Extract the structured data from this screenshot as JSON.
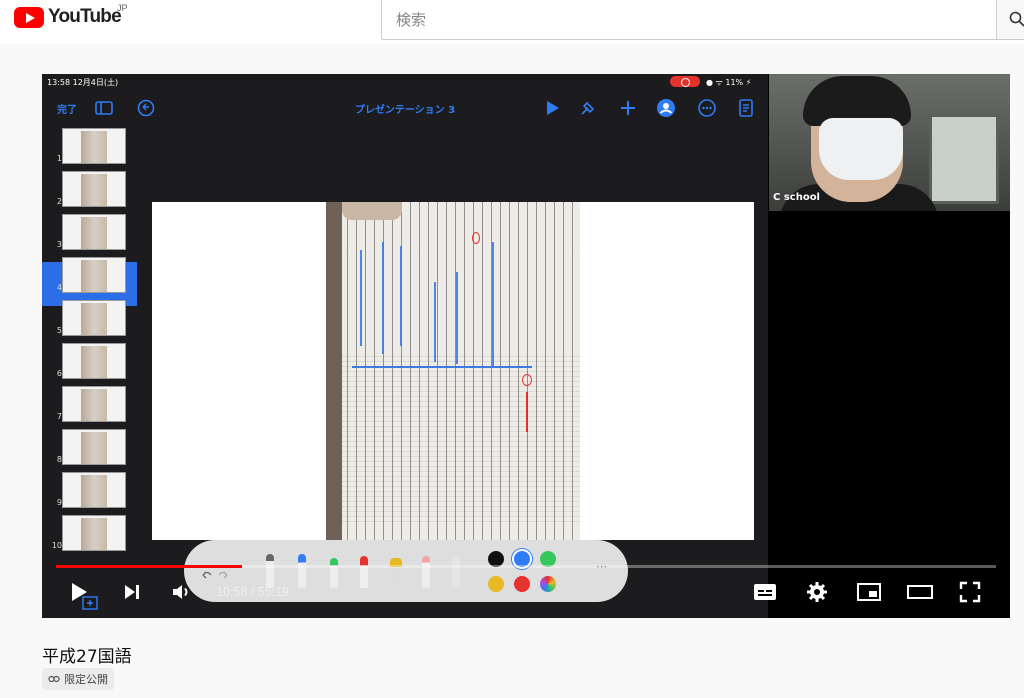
{
  "header": {
    "logo_text": "YouTube",
    "region": "JP",
    "search_placeholder": "検索"
  },
  "ipad": {
    "status_time": "13:58  12月4日(土)",
    "status_right": "● ᯤ 11% ⚡",
    "toolbar_done": "完了",
    "presentation_title": "プレゼンテーション 3",
    "slide_numbers": [
      "1",
      "2",
      "3",
      "4",
      "5",
      "6",
      "7",
      "8",
      "9",
      "10"
    ],
    "selected_slide": "3"
  },
  "webcam": {
    "label": "C school"
  },
  "palette": {
    "colors": [
      "#111111",
      "#2f7cf6",
      "#35c759",
      "#e8b923",
      "#e5322c"
    ],
    "more": "···"
  },
  "player": {
    "time_current": "10:58",
    "time_separator": " / ",
    "time_total": "55:19",
    "progress": 0.198
  },
  "video": {
    "title": "平成27国語",
    "visibility": "限定公開"
  },
  "colors": {
    "accent": "#ff0000",
    "ipad_blue": "#2f7cf6"
  }
}
